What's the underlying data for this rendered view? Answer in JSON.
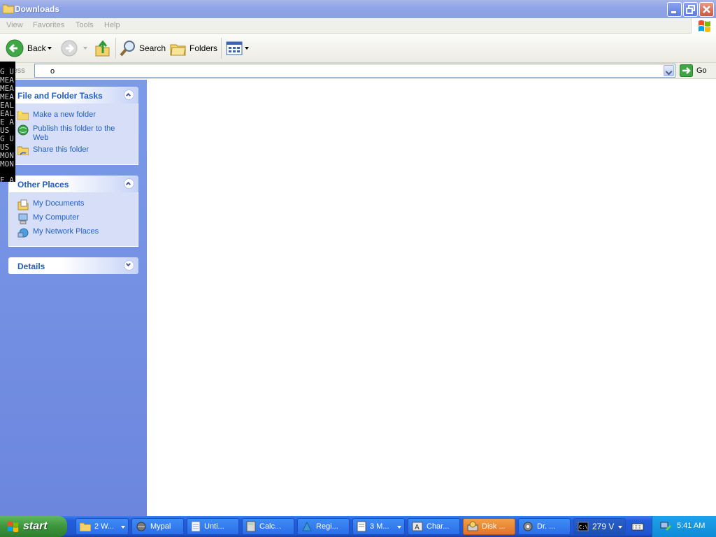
{
  "window": {
    "title": "Downloads"
  },
  "menu": [
    "View",
    "Favorites",
    "Tools",
    "Help"
  ],
  "toolbar": {
    "back": "Back",
    "search": "Search",
    "folders": "Folders"
  },
  "address": {
    "label": "ress",
    "value": "o",
    "go": "Go"
  },
  "console_lines": [
    "G U",
    "MEA",
    "MEA",
    "MEA",
    "EAL",
    "EAL",
    "E A",
    "US ",
    "G U",
    "US ",
    "MON",
    "MON",
    "",
    "E A"
  ],
  "panels": {
    "tasks": {
      "title": "File and Folder Tasks",
      "items": [
        "Make a new folder",
        "Publish this folder to the Web",
        "Share this folder"
      ]
    },
    "places": {
      "title": "Other Places",
      "items": [
        "My Documents",
        "My Computer",
        "My Network Places"
      ]
    },
    "details": {
      "title": "Details"
    }
  },
  "taskbar": {
    "start": "start",
    "tasks": [
      "2 W...",
      "Mypal",
      "Unti...",
      "Calc...",
      "Regi...",
      "3 M...",
      "Char...",
      "Disk ...",
      "Dr. ...",
      "279 V"
    ],
    "clock": "5:41 AM"
  }
}
